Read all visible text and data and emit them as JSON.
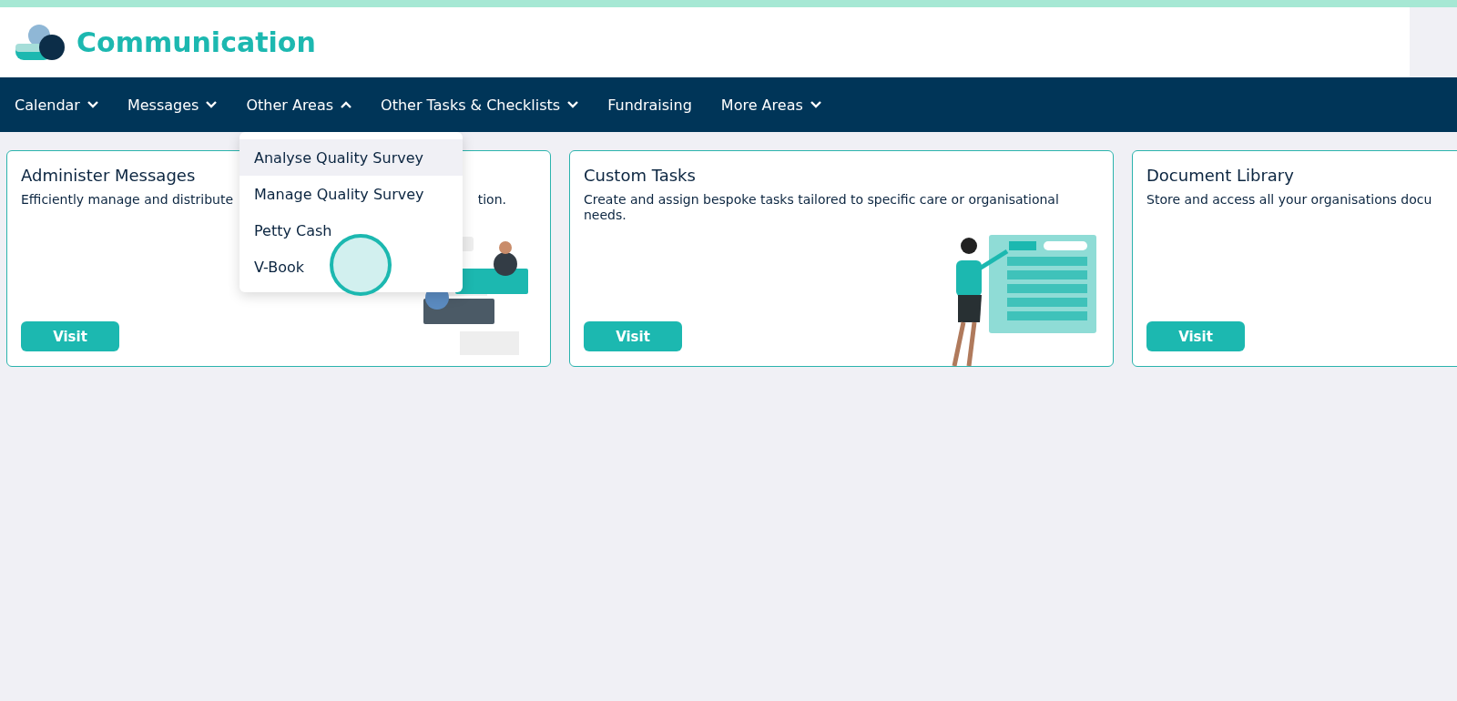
{
  "header": {
    "title": "Communication"
  },
  "nav": [
    {
      "label": "Calendar",
      "expanded": false
    },
    {
      "label": "Messages",
      "expanded": false
    },
    {
      "label": "Other Areas",
      "expanded": true
    },
    {
      "label": "Other Tasks & Checklists",
      "expanded": false
    },
    {
      "label": "Fundraising"
    },
    {
      "label": "More Areas",
      "expanded": false
    }
  ],
  "menu": [
    {
      "label": "Analyse Quality Survey",
      "highlighted": true
    },
    {
      "label": "Manage Quality Survey",
      "highlighted": false
    },
    {
      "label": "Petty Cash",
      "highlighted": false
    },
    {
      "label": "V-Book",
      "highlighted": false
    }
  ],
  "cards": [
    {
      "title": "Administer Messages",
      "description": [
        "Efficiently manage and distribute",
        "tion."
      ],
      "button": "Visit",
      "illustration": {
        "kind": "chat"
      }
    },
    {
      "title": "Custom Tasks",
      "description": [
        "Create and assign bespoke tasks tailored to specific care or organisational needs."
      ],
      "button": "Visit",
      "illustration": {
        "kind": "tasks"
      }
    },
    {
      "title": "Document Library",
      "description": [
        "Store and access all your organisations docu"
      ],
      "button": "Visit"
    }
  ]
}
